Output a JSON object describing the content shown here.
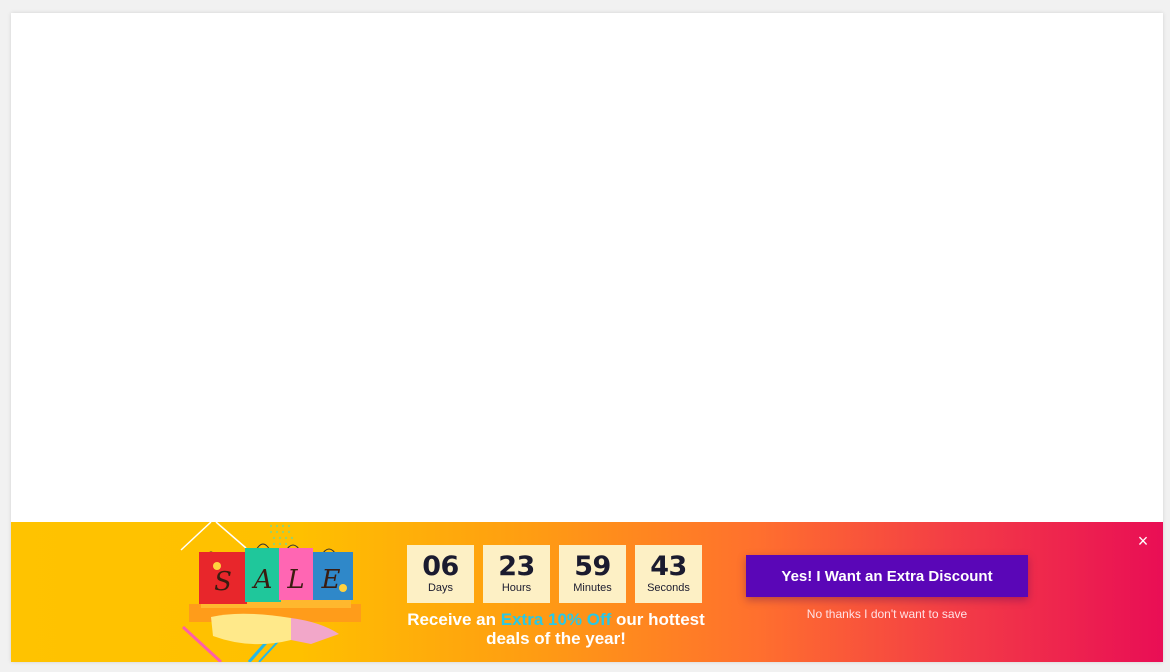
{
  "countdown": [
    {
      "value": "06",
      "label": "Days"
    },
    {
      "value": "23",
      "label": "Hours"
    },
    {
      "value": "59",
      "label": "Minutes"
    },
    {
      "value": "43",
      "label": "Seconds"
    }
  ],
  "offer": {
    "prefix": "Receive an ",
    "highlight": "Extra 10% Off",
    "suffix_line1": " our hottest",
    "line2": "deals of the year!"
  },
  "cta": {
    "label": "Yes! I Want an Extra Discount"
  },
  "decline": {
    "label": "No thanks I don't want to save"
  },
  "close": {
    "icon": "×"
  },
  "illustration": {
    "bag_letters": [
      "S",
      "A",
      "L",
      "E"
    ]
  },
  "colors": {
    "banner_start": "#ffc300",
    "banner_end": "#e90e55",
    "cta_bg": "#5a06b7",
    "highlight": "#29c8e6",
    "countdown_bg": "#fdf0c5"
  }
}
